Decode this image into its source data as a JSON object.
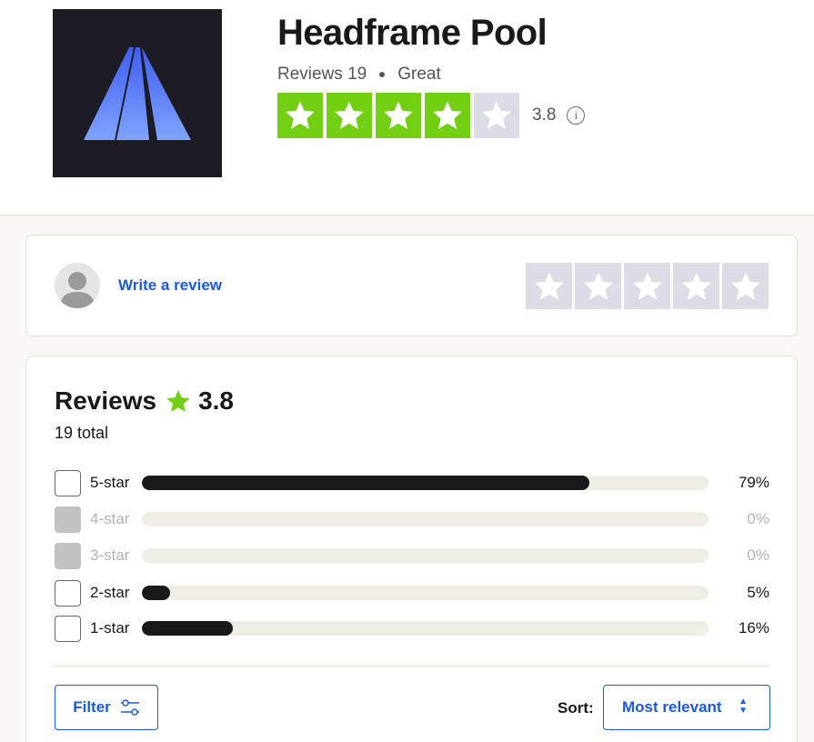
{
  "business": {
    "name": "Headframe Pool",
    "reviews_label": "Reviews 19",
    "rating_word": "Great",
    "rating_value": "3.8",
    "stars_filled": 4,
    "stars_total": 5,
    "info_glyph": "i"
  },
  "write_review": {
    "link_label": "Write a review",
    "avatar_icon": "user-avatar-icon",
    "empty_stars": 5
  },
  "reviews": {
    "heading": "Reviews",
    "rating_value": "3.8",
    "total_label": "19 total",
    "distribution": [
      {
        "label": "5-star",
        "percent_label": "79%",
        "fraction": 0.79,
        "enabled": true
      },
      {
        "label": "4-star",
        "percent_label": "0%",
        "fraction": 0,
        "enabled": false
      },
      {
        "label": "3-star",
        "percent_label": "0%",
        "fraction": 0,
        "enabled": false
      },
      {
        "label": "2-star",
        "percent_label": "5%",
        "fraction": 0.05,
        "enabled": true
      },
      {
        "label": "1-star",
        "percent_label": "16%",
        "fraction": 0.16,
        "enabled": true
      }
    ]
  },
  "controls": {
    "filter_label": "Filter",
    "sort_label": "Sort:",
    "sort_value": "Most relevant"
  },
  "colors": {
    "star_green": "#73cf11",
    "star_empty": "#dcdce6",
    "link_blue": "#1b5ae0",
    "bar_fill": "#191919",
    "logo_bg": "#1d1c24"
  }
}
